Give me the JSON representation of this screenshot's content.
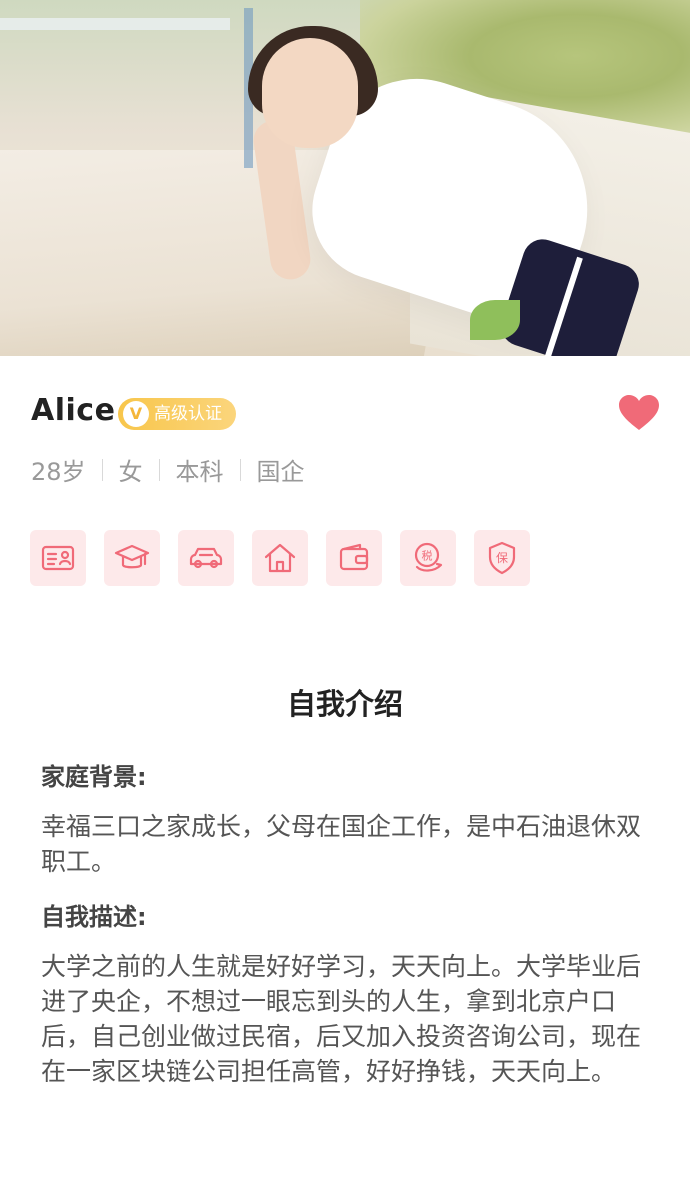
{
  "profile": {
    "name": "Alice",
    "badge_label": "高级认证",
    "badge_mark": "V",
    "age": "28岁",
    "gender": "女",
    "education": "本科",
    "employer": "国企",
    "liked": true
  },
  "verification_icons": [
    {
      "name": "id-card-icon"
    },
    {
      "name": "graduation-cap-icon"
    },
    {
      "name": "car-icon"
    },
    {
      "name": "house-icon"
    },
    {
      "name": "wallet-icon"
    },
    {
      "name": "tax-icon",
      "glyph": "税"
    },
    {
      "name": "insurance-icon",
      "glyph": "保"
    }
  ],
  "intro": {
    "title": "自我介绍",
    "family_label": "家庭背景:",
    "family_text": "幸福三口之家成长，父母在国企工作，是中石油退休双职工。",
    "self_label": "自我描述:",
    "self_text": "大学之前的人生就是好好学习，天天向上。大学毕业后进了央企，不想过一眼忘到头的人生，拿到北京户口后，自己创业做过民宿，后又加入投资咨询公司，现在在一家区块链公司担任高管，好好挣钱，天天向上。"
  },
  "colors": {
    "accent": "#f06a78",
    "badge": "#f8c64b",
    "icon_bg": "#fde9ea"
  }
}
